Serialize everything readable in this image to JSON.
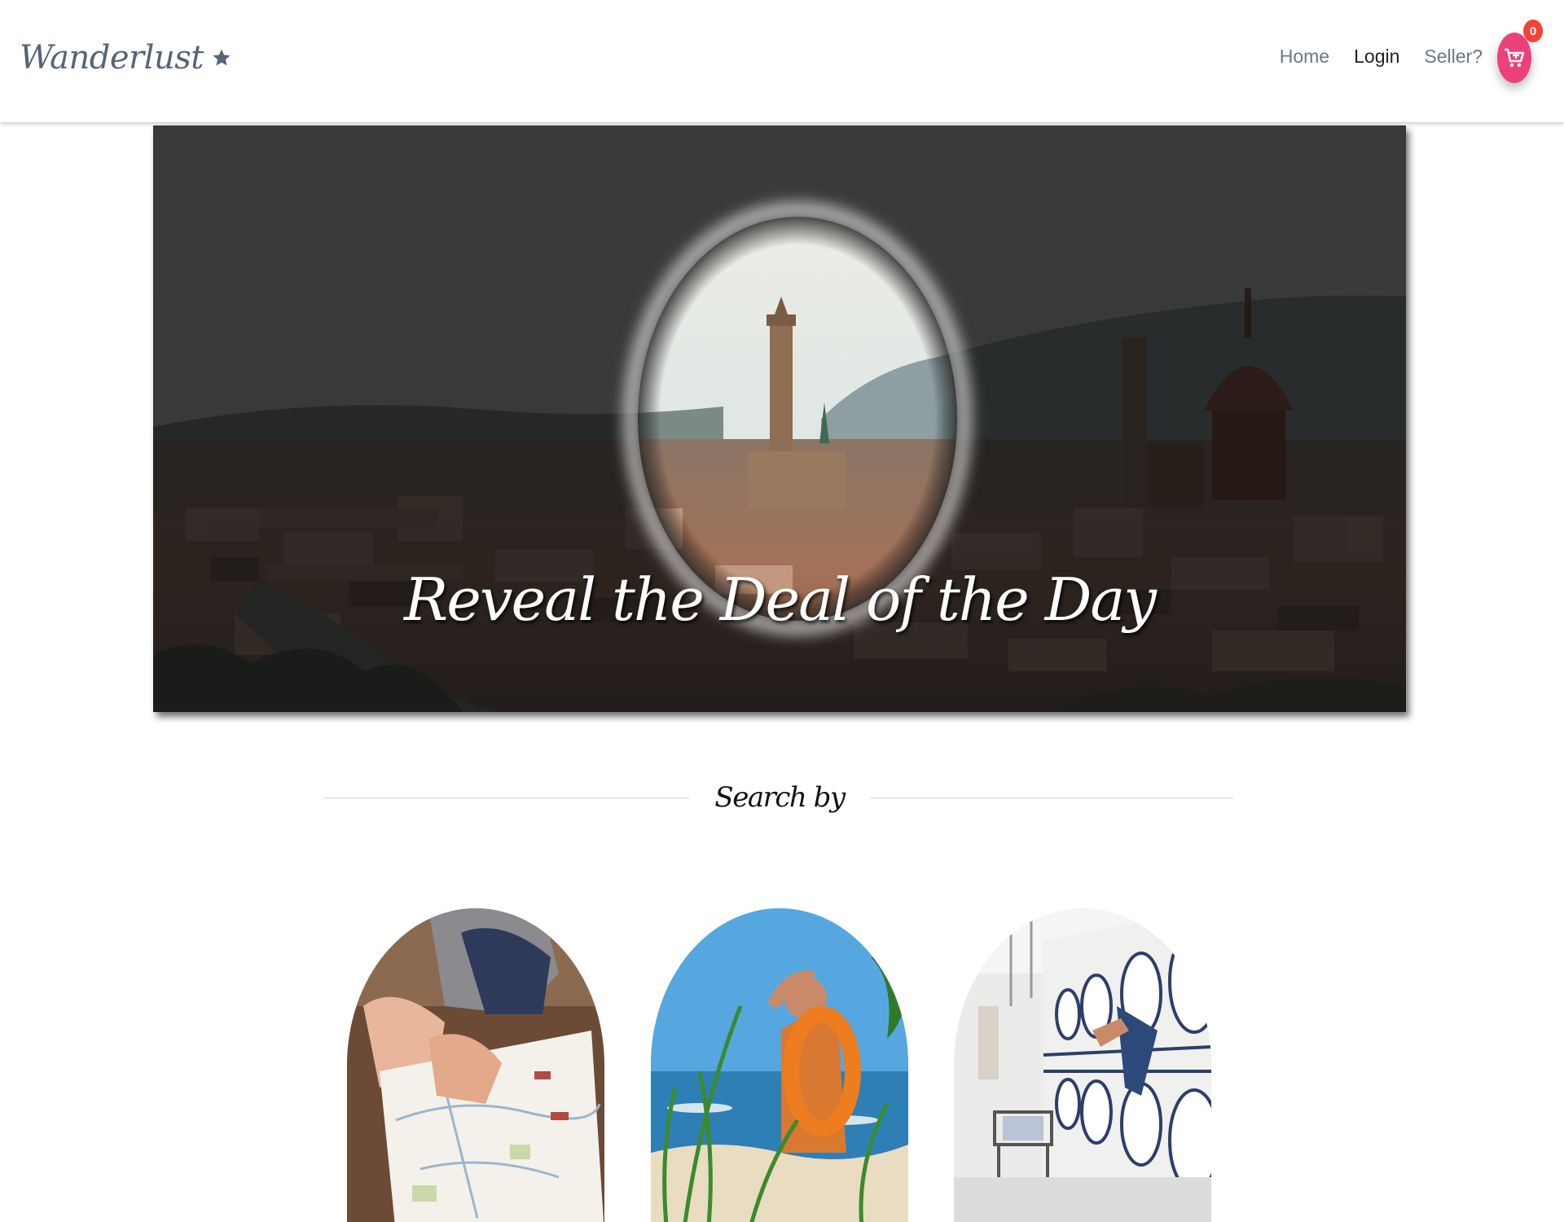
{
  "brand": {
    "name": "Wanderlust",
    "icon": "star-icon"
  },
  "nav": {
    "links": [
      {
        "label": "Home"
      },
      {
        "label": "Login"
      },
      {
        "label": "Seller?"
      }
    ],
    "cart": {
      "icon": "cart-icon",
      "count": "0"
    }
  },
  "hero": {
    "caption": "Reveal the Deal of the Day",
    "image": "florence-skyline-spotlight"
  },
  "search": {
    "heading": "Search by",
    "categories": [
      {
        "image": "map-reading"
      },
      {
        "image": "beach-lookout"
      },
      {
        "image": "laundromat"
      }
    ]
  },
  "colors": {
    "brand_text": "#53657a",
    "cart_accent": "#ec407a",
    "badge": "#f44336"
  }
}
